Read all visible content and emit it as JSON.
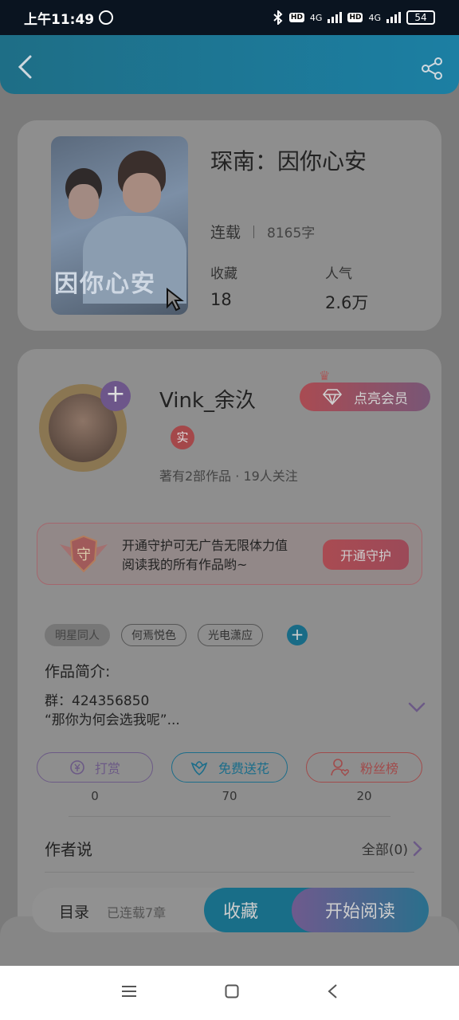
{
  "status_bar": {
    "time": "上午11:49",
    "network_labels": [
      "HD",
      "4G",
      "HD",
      "4G"
    ],
    "battery": "54"
  },
  "header": {
    "back_icon": "chevron-left-icon",
    "share_icon": "share-icon"
  },
  "book": {
    "cover_text": "因你心安",
    "title": "琛南：因你心安",
    "status": "连载",
    "word_count": "8165字",
    "favorites_label": "收藏",
    "favorites_value": "18",
    "popularity_label": "人气",
    "popularity_value": "2.6万"
  },
  "author": {
    "name": "Vink_余汣",
    "real_badge": "实",
    "works_info": "著有2部作品 · 19人关注",
    "follow_plus": "+",
    "vip_button": "点亮会员"
  },
  "guard": {
    "shield_text": "守",
    "line1": "开通守护可无广告无限体力值",
    "line2": "阅读我的所有作品哟~",
    "button": "开通守护"
  },
  "tags": [
    "明星同人",
    "何焉悦色",
    "光电潇应"
  ],
  "tag_add": "+",
  "intro": {
    "title": "作品简介:",
    "line1": "群：424356850",
    "line2": "“那你为何会选我呢”..."
  },
  "actions": [
    {
      "label": "打赏",
      "count": "0",
      "icon": "yen-coin-icon"
    },
    {
      "label": "免费送花",
      "count": "70",
      "icon": "flower-icon"
    },
    {
      "label": "粉丝榜",
      "count": "20",
      "icon": "user-heart-icon"
    }
  ],
  "author_says": {
    "title": "作者说",
    "all_link": "全部(0)"
  },
  "bottom_bar": {
    "catalog": "目录",
    "chapters": "已连载7章",
    "collect": "收藏",
    "read": "开始阅读"
  },
  "colors": {
    "header": "#1c7fa3",
    "overlay_background": "#7a7a7a",
    "card": "#8e8e8e",
    "accent_red": "#a94b52",
    "accent_purple": "#6c5a86",
    "accent_blue": "#1c6d8a"
  }
}
